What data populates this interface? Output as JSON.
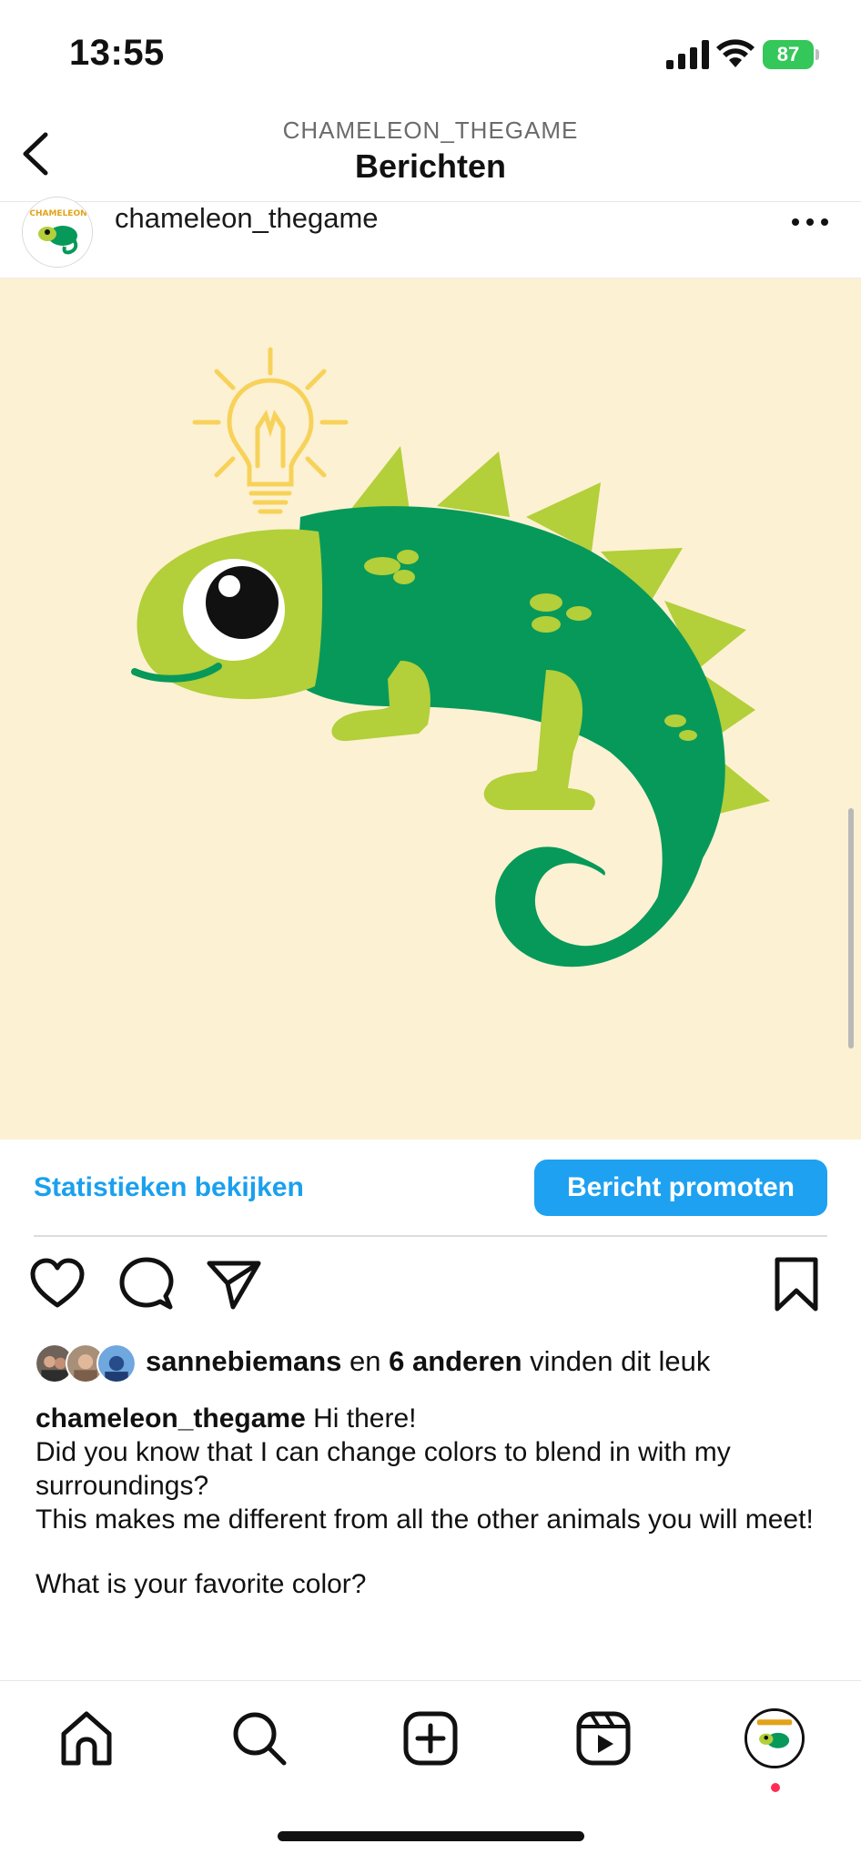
{
  "status_bar": {
    "time": "13:55",
    "battery": "87"
  },
  "header": {
    "subtitle": "CHAMELEON_THEGAME",
    "title": "Berichten",
    "back_icon": "chevron-left-icon"
  },
  "post": {
    "username": "chameleon_thegame",
    "avatar_logo_text": "CHAMELEON",
    "image_description_icon": "chameleon-illustration",
    "colors": {
      "background": "#fcf1d2",
      "body_green": "#07995a",
      "light_green": "#b3cf3a",
      "bulb": "#f7d25a"
    }
  },
  "promo": {
    "stats_link": "Statistieken bekijken",
    "promote_button": "Bericht promoten",
    "accent_color": "#1ea1f1"
  },
  "actions": {
    "like_icon": "heart-icon",
    "comment_icon": "comment-icon",
    "share_icon": "send-icon",
    "save_icon": "bookmark-icon"
  },
  "likes": {
    "first_liker": "sannebiemans",
    "connector": " en ",
    "others": "6 anderen",
    "suffix": " vinden dit leuk"
  },
  "caption": {
    "username": "chameleon_thegame",
    "line1": " Hi there!",
    "line2": "Did you know that I can change colors to blend in with my surroundings?",
    "line3": "This makes me different from all the other animals you will meet!",
    "line4": "What is your favorite color?"
  },
  "bottom_nav": {
    "items": [
      "home-icon",
      "search-icon",
      "create-post-icon",
      "reels-icon",
      "profile-avatar"
    ]
  }
}
